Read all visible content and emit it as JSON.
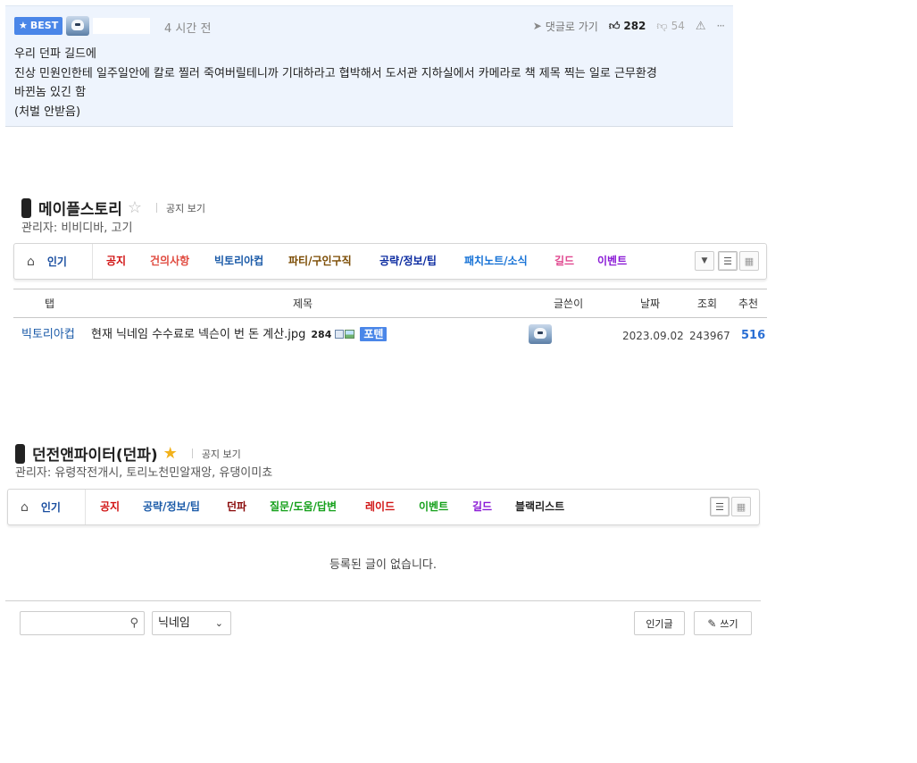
{
  "comment": {
    "badge": "BEST",
    "time": "4 시간 전",
    "goto_label": "댓글로 가기",
    "likes": "282",
    "dislikes": "54",
    "lines": [
      "우리 던파 길드에",
      "진상 민원인한테 일주일안에 칼로 찔러 죽여버릴테니까 기대하라고 협박해서 도서관 지하실에서 카메라로 책 제목 찍는 일로 근무환경",
      "바뀐놈 있긴 함",
      "(처벌 안받음)"
    ]
  },
  "maple": {
    "title": "메이플스토리",
    "notice": "공지 보기",
    "admins": "관리자: 비비디바, 고기",
    "nav": {
      "home": "인기",
      "items": [
        {
          "label": "공지",
          "color": "#d11414"
        },
        {
          "label": "건의사항",
          "color": "#e04a3f"
        },
        {
          "label": "빅토리아컵",
          "color": "#1a5aa8"
        },
        {
          "label": "파티/구인구직",
          "color": "#7a4a00"
        },
        {
          "label": "공략/정보/팁",
          "color": "#0a2aa0"
        },
        {
          "label": "패치노트/소식",
          "color": "#1672d6"
        },
        {
          "label": "길드",
          "color": "#e0488f"
        },
        {
          "label": "이벤트",
          "color": "#8a1ad6"
        }
      ]
    },
    "table": {
      "headers": [
        "탭",
        "제목",
        "글쓴이",
        "날짜",
        "조회",
        "추천"
      ],
      "rows": [
        {
          "category": "빅토리아컵",
          "title": "현재 닉네임 수수료로 넥슨이 번 돈 계산.jpg",
          "comments": "284",
          "tag": "포텐",
          "date": "2023.09.02",
          "views": "243967",
          "votes": "516"
        }
      ]
    }
  },
  "dnf": {
    "title": "던전앤파이터(던파)",
    "notice": "공지 보기",
    "admins": "관리자: 유령작전개시, 토리노천민알재앙, 유댕이미쵸",
    "nav": {
      "home": "인기",
      "items": [
        {
          "label": "공지",
          "color": "#d11414"
        },
        {
          "label": "공략/정보/팁",
          "color": "#1a5aa8"
        },
        {
          "label": "던파",
          "color": "#8a0a0a"
        },
        {
          "label": "질문/도움/답변",
          "color": "#14a01a"
        },
        {
          "label": "레이드",
          "color": "#d11414"
        },
        {
          "label": "이벤트",
          "color": "#14a01a"
        },
        {
          "label": "길드",
          "color": "#8a1ad6"
        },
        {
          "label": "블랙리스트",
          "color": "#222222"
        }
      ]
    },
    "empty": "등록된 글이 없습니다."
  },
  "bottom": {
    "search_value": "",
    "select_value": "닉네임",
    "popular_btn": "인기글",
    "write_btn": "쓰기"
  }
}
